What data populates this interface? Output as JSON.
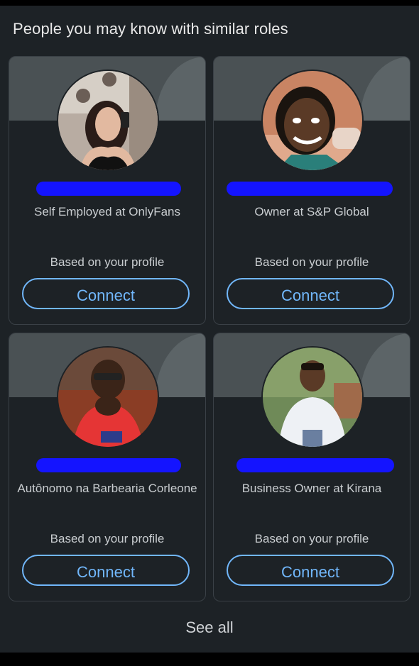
{
  "section": {
    "title": "People you may know with similar roles"
  },
  "cards": [
    {
      "headline": "Self Employed at OnlyFans",
      "reason": "Based on your profile",
      "button": "Connect",
      "avatar": "person-photo"
    },
    {
      "headline": "Owner at S&P Global",
      "reason": "Based on your profile",
      "button": "Connect",
      "avatar": "person-photo"
    },
    {
      "headline": "Autônomo na Barbearia Corleone",
      "reason": "Based on your profile",
      "button": "Connect",
      "avatar": "person-photo"
    },
    {
      "headline": "Business Owner at Kirana",
      "reason": "Based on your profile",
      "button": "Connect",
      "avatar": "person-photo"
    }
  ],
  "footer": {
    "see_all": "See all"
  },
  "colors": {
    "background": "#1d2226",
    "accent": "#71b7fb",
    "redaction": "#1414ff"
  }
}
